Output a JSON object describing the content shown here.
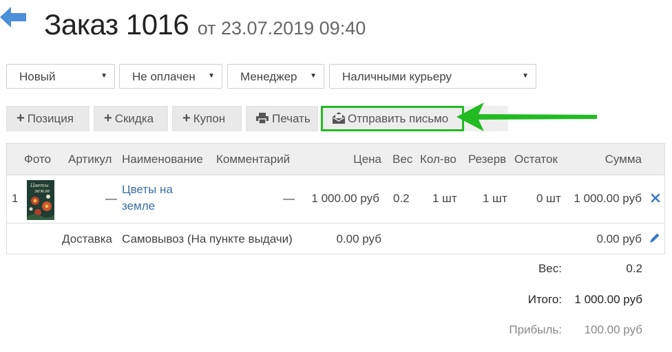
{
  "header": {
    "title": "Заказ 1016",
    "subtitle": "от 23.07.2019 09:40"
  },
  "filters": [
    {
      "value": "Новый"
    },
    {
      "value": "Не оплачен"
    },
    {
      "value": "Менеджер"
    },
    {
      "value": "Наличными курьеру"
    }
  ],
  "toolbar": {
    "position": "Позиция",
    "discount": "Скидка",
    "coupon": "Купон",
    "print": "Печать",
    "send_email": "Отправить письмо"
  },
  "table": {
    "columns": {
      "photo": "Фото",
      "sku": "Артикул",
      "name": "Наименование",
      "comment": "Комментарий",
      "price": "Цена",
      "weight": "Вес",
      "qty": "Кол-во",
      "reserve": "Резерв",
      "stock": "Остаток",
      "sum": "Сумма"
    },
    "item": {
      "index": "1",
      "sku": "—",
      "name_line1": "Цветы на",
      "name_line2": "земле",
      "comment": "—",
      "price": "1 000.00 руб",
      "weight": "0.2",
      "qty": "1 шт",
      "reserve": "1 шт",
      "stock": "0 шт",
      "sum": "1 000.00 руб"
    },
    "delivery": {
      "label": "Доставка",
      "method": "Самовывоз (На пункте выдачи)",
      "price": "0.00 руб",
      "sum": "0.00 руб"
    }
  },
  "summary": {
    "weight_label": "Вес:",
    "weight_value": "0.2",
    "total_label": "Итого:",
    "total_value": "1 000.00 руб",
    "profit_label": "Прибыль:",
    "profit_value": "100.00 руб"
  },
  "colors": {
    "accent_blue": "#4a90d9",
    "highlight_green": "#22bb22",
    "link": "#3a6ea5"
  }
}
